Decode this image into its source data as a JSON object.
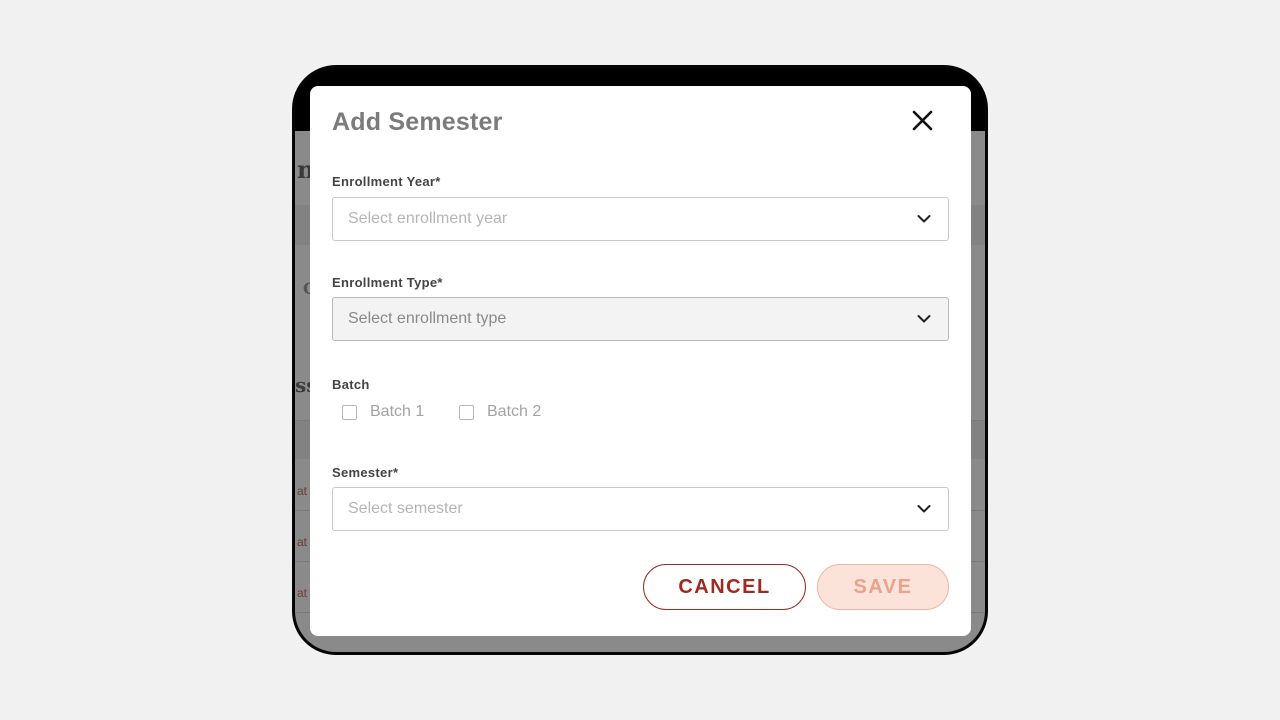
{
  "modal": {
    "title": "Add Semester",
    "close_icon": "close-icon",
    "fields": {
      "enrollment_year": {
        "label": "Enrollment Year*",
        "placeholder": "Select enrollment year",
        "icon": "chevron-down-icon"
      },
      "enrollment_type": {
        "label": "Enrollment Type*",
        "placeholder": "Select enrollment type",
        "icon": "chevron-down-icon",
        "disabled": true
      },
      "batch": {
        "label": "Batch",
        "options": [
          {
            "label": "Batch 1",
            "checked": false
          },
          {
            "label": "Batch 2",
            "checked": false
          }
        ]
      },
      "semester": {
        "label": "Semester*",
        "placeholder": "Select semester",
        "icon": "chevron-down-icon"
      }
    },
    "buttons": {
      "cancel": "CANCEL",
      "save": "SAVE"
    }
  },
  "colors": {
    "accent": "#9d2b22",
    "save_disabled_bg": "#fbe3da",
    "save_disabled_text": "#e9a38d",
    "overlay": "#8a8a8a",
    "page_bg": "#f1f1f1"
  }
}
